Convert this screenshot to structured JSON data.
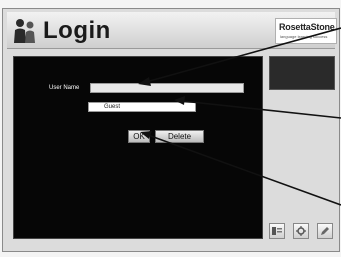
{
  "header": {
    "title": "Login",
    "brand_name": "RosettaStone",
    "brand_tagline": "language learning success"
  },
  "form": {
    "user_name_label": "User Name",
    "user_name_value": "",
    "selected_user": "Guest",
    "ok_label": "OK",
    "delete_label": "Delete"
  },
  "icons": {
    "header": "people-icon",
    "toolbar": [
      "account-icon",
      "settings-icon",
      "edit-icon"
    ]
  },
  "colors": {
    "panel_background": "#060606",
    "window_background": "#dcdcdc",
    "callout_arrows": "#111111"
  }
}
